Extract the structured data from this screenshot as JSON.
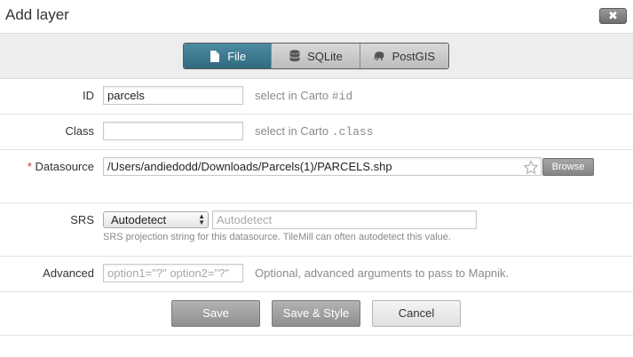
{
  "dialog": {
    "title": "Add layer",
    "close_label": "✖"
  },
  "tabs": [
    {
      "label": "File",
      "icon": "file-icon",
      "active": true
    },
    {
      "label": "SQLite",
      "icon": "database-icon",
      "active": false
    },
    {
      "label": "PostGIS",
      "icon": "elephant-icon",
      "active": false
    }
  ],
  "fields": {
    "id": {
      "label": "ID",
      "value": "parcels",
      "hint_prefix": "select in Carto",
      "hint_code": "#id"
    },
    "class": {
      "label": "Class",
      "value": "",
      "hint_prefix": "select in Carto",
      "hint_code": ".class"
    },
    "datasource": {
      "required_marker": "*",
      "label": "Datasource",
      "value": "/Users/andiedodd/Downloads/Parcels(1)/PARCELS.shp",
      "browse_label": "Browse"
    },
    "srs": {
      "label": "SRS",
      "selected": "Autodetect",
      "placeholder": "Autodetect",
      "hint": "SRS projection string for this datasource. TileMill can often autodetect this value."
    },
    "advanced": {
      "label": "Advanced",
      "placeholder": "option1=\"?\" option2=\"?\"",
      "hint": "Optional, advanced arguments to pass to Mapnik."
    }
  },
  "buttons": {
    "save": "Save",
    "save_style": "Save & Style",
    "cancel": "Cancel"
  },
  "colors": {
    "active_tab": "#3b7a91",
    "required": "#c0392b"
  }
}
